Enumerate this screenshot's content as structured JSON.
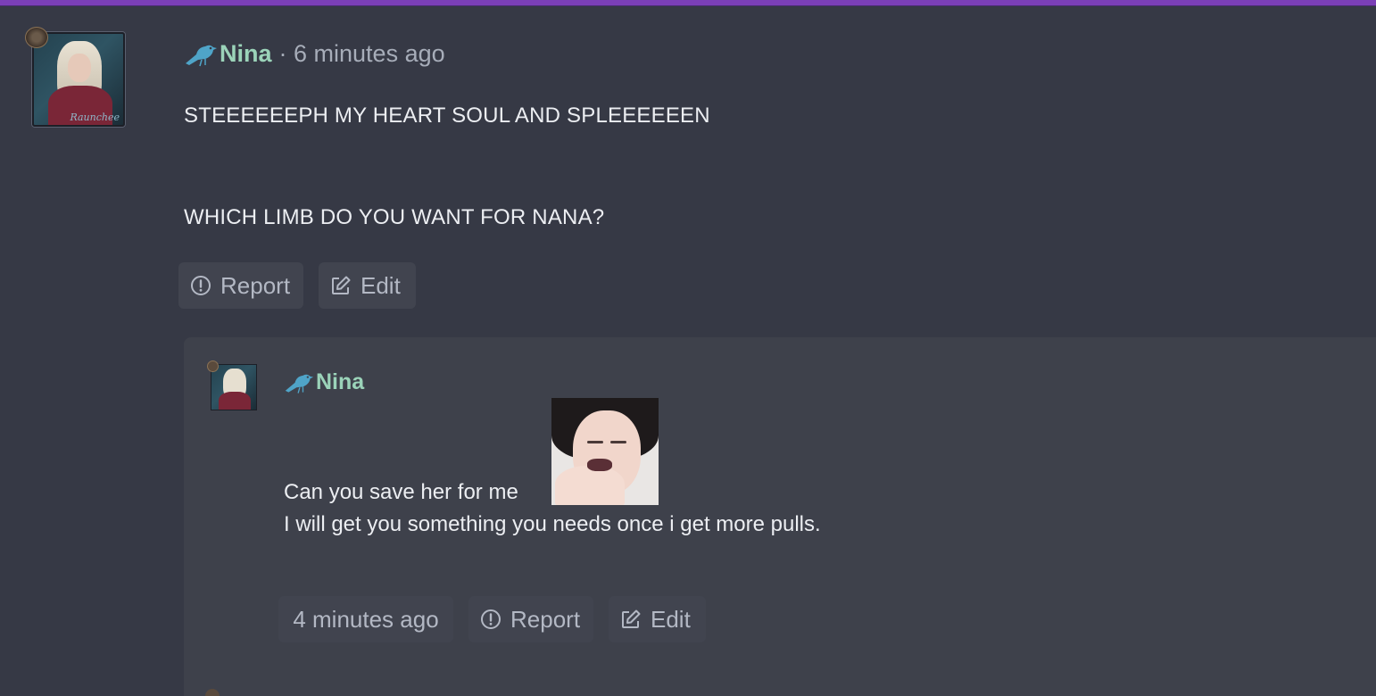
{
  "comment": {
    "author": "Nina",
    "time": "· 6 minutes ago",
    "lines": [
      "STEEEEEEPH MY HEART SOUL AND SPLEEEEEEN",
      "WHICH LIMB DO YOU WANT FOR NANA?"
    ],
    "actions": {
      "report": "Report",
      "edit": "Edit"
    },
    "avatar_signature": "Raunchee"
  },
  "reply": {
    "author": "Nina",
    "line1": "Can you save her for me",
    "line2": "I will get you something you needs once i get more pulls.",
    "time": "4 minutes ago",
    "actions": {
      "report": "Report",
      "edit": "Edit"
    }
  },
  "colors": {
    "background": "#363945",
    "reply_background": "#3e414b",
    "accent_top_border": "#7b3fb7",
    "author_name": "#9bd3b9",
    "bird_icon": "#4fa4c8",
    "button_background": "#41444f"
  },
  "icons": [
    "bird-icon",
    "alert-circle-icon",
    "edit-icon"
  ]
}
